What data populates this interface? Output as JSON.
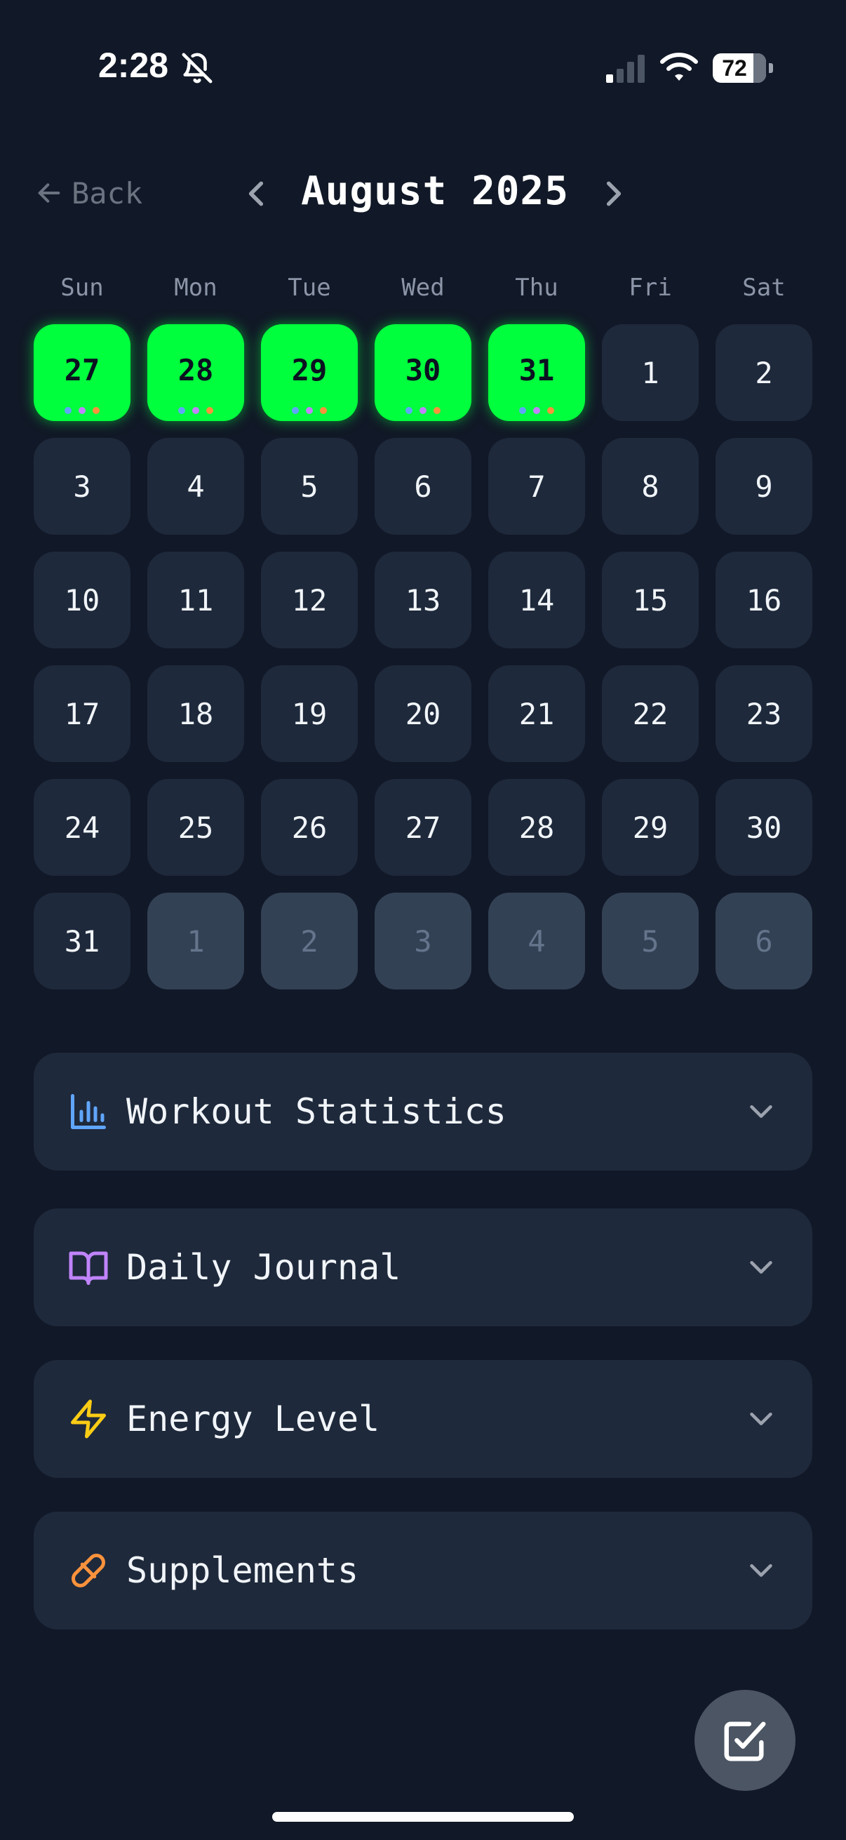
{
  "status_bar": {
    "time": "2:28",
    "battery": "72",
    "icons": [
      "bell-slash-icon",
      "cellular-signal-icon",
      "wifi-icon",
      "battery-icon"
    ]
  },
  "header": {
    "back_label": "Back",
    "month_title": "August 2025"
  },
  "calendar": {
    "weekdays": [
      "Sun",
      "Mon",
      "Tue",
      "Wed",
      "Thu",
      "Fri",
      "Sat"
    ],
    "days": [
      {
        "label": "27",
        "state": "active"
      },
      {
        "label": "28",
        "state": "active"
      },
      {
        "label": "29",
        "state": "active"
      },
      {
        "label": "30",
        "state": "active"
      },
      {
        "label": "31",
        "state": "active"
      },
      {
        "label": "1",
        "state": "normal"
      },
      {
        "label": "2",
        "state": "normal"
      },
      {
        "label": "3",
        "state": "normal"
      },
      {
        "label": "4",
        "state": "normal"
      },
      {
        "label": "5",
        "state": "normal"
      },
      {
        "label": "6",
        "state": "normal"
      },
      {
        "label": "7",
        "state": "normal"
      },
      {
        "label": "8",
        "state": "normal"
      },
      {
        "label": "9",
        "state": "normal"
      },
      {
        "label": "10",
        "state": "normal"
      },
      {
        "label": "11",
        "state": "normal"
      },
      {
        "label": "12",
        "state": "normal"
      },
      {
        "label": "13",
        "state": "normal"
      },
      {
        "label": "14",
        "state": "normal"
      },
      {
        "label": "15",
        "state": "normal"
      },
      {
        "label": "16",
        "state": "normal"
      },
      {
        "label": "17",
        "state": "normal"
      },
      {
        "label": "18",
        "state": "normal"
      },
      {
        "label": "19",
        "state": "normal"
      },
      {
        "label": "20",
        "state": "normal"
      },
      {
        "label": "21",
        "state": "normal"
      },
      {
        "label": "22",
        "state": "normal"
      },
      {
        "label": "23",
        "state": "normal"
      },
      {
        "label": "24",
        "state": "normal"
      },
      {
        "label": "25",
        "state": "normal"
      },
      {
        "label": "26",
        "state": "normal"
      },
      {
        "label": "27",
        "state": "normal"
      },
      {
        "label": "28",
        "state": "normal"
      },
      {
        "label": "29",
        "state": "normal"
      },
      {
        "label": "30",
        "state": "normal"
      },
      {
        "label": "31",
        "state": "normal"
      },
      {
        "label": "1",
        "state": "other"
      },
      {
        "label": "2",
        "state": "other"
      },
      {
        "label": "3",
        "state": "other"
      },
      {
        "label": "4",
        "state": "other"
      },
      {
        "label": "5",
        "state": "other"
      },
      {
        "label": "6",
        "state": "other"
      }
    ],
    "indicator_dot_colors": [
      "#60a5fa",
      "#c084fc",
      "#fb923c"
    ]
  },
  "sections": [
    {
      "label": "Workout Statistics",
      "icon": "bar-chart-icon",
      "color": "#60a5fa"
    },
    {
      "label": "Daily Journal",
      "icon": "open-book-icon",
      "color": "#c084fc"
    },
    {
      "label": "Energy Level",
      "icon": "lightning-bolt-icon",
      "color": "#facc15"
    },
    {
      "label": "Supplements",
      "icon": "pill-icon",
      "color": "#fb923c"
    }
  ],
  "fab": {
    "icon": "checkbox-edit-icon"
  },
  "colors": {
    "background": "#111827",
    "card": "#1e293b",
    "active_day": "#00ff3c",
    "muted_day": "#334155"
  }
}
